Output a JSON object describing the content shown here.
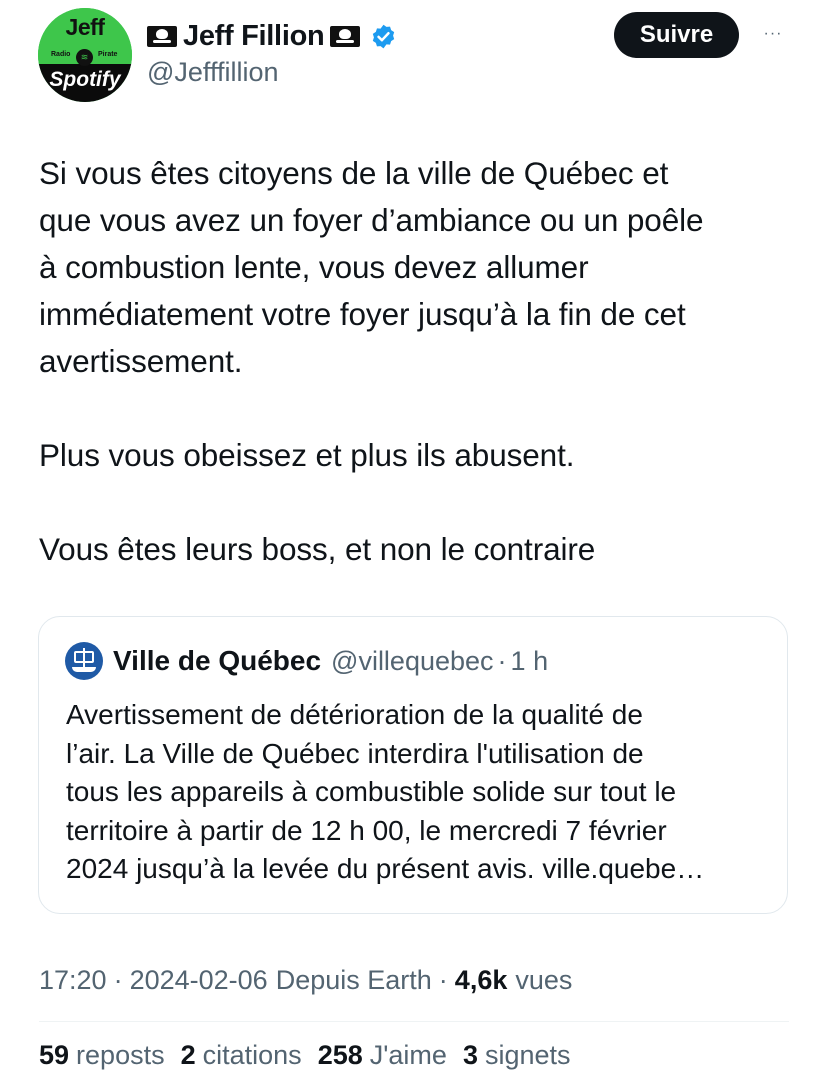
{
  "author": {
    "avatar": {
      "top_text": "Jeff",
      "small_left": "Radio",
      "small_right": "Pirate",
      "bottom_text": "Spotify"
    },
    "name": "Jeff Fillion",
    "handle": "@Jefffillion",
    "verified": true,
    "flag_icon": "pirate-flag-icon"
  },
  "actions": {
    "follow_label": "Suivre",
    "more_label": "···"
  },
  "tweet": {
    "paragraphs": [
      "Si vous êtes citoyens de la ville de Québec et\nque vous avez un foyer d’ambiance ou un poêle\nà combustion lente, vous devez allumer\nimmédiatement votre foyer jusqu’à la fin de cet\navertissement.",
      "Plus vous obeissez et plus ils abusent.",
      "Vous êtes leurs boss, et non le contraire"
    ]
  },
  "quote": {
    "name": "Ville de Québec",
    "handle": "@villequebec",
    "separator": "·",
    "time": "1 h",
    "text": "Avertissement de détérioration de la qualité de\nl’air. La Ville de Québec interdira l'utilisation de\ntous les appareils à combustible solide sur tout le\nterritoire à partir de 12 h 00, le mercredi 7 février\n2024 jusqu’à la levée du présent avis. ville.quebe…"
  },
  "meta": {
    "time": "17:20",
    "date": "2024-02-06",
    "source": "Depuis Earth",
    "separator": "·",
    "views_count": "4,6k",
    "views_label": "vues"
  },
  "stats": [
    {
      "count": "59",
      "label": "reposts"
    },
    {
      "count": "2",
      "label": "citations"
    },
    {
      "count": "258",
      "label": "J'aime"
    },
    {
      "count": "3",
      "label": "signets"
    }
  ],
  "colors": {
    "text": "#0f1419",
    "secondary": "#536471",
    "verified_blue": "#1d9bf0",
    "border": "#e1e8ed"
  }
}
